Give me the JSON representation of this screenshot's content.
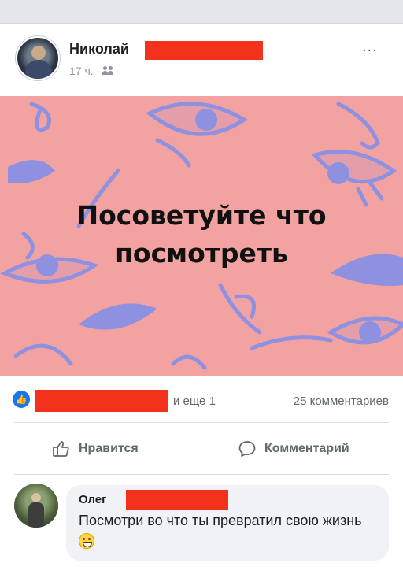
{
  "post": {
    "author": "Николай",
    "time": "17 ч.",
    "meta_separator": "·",
    "privacy_icon": "friends-icon",
    "more_label": "...",
    "image_text": {
      "line1": "Посоветуйте что",
      "line2": "посмотреть"
    },
    "colors": {
      "image_bg": "#f3a2a2",
      "doodle": "#8e90e0",
      "like_blue": "#1877f2",
      "redaction": "#f2321a"
    }
  },
  "reactions": {
    "and_more": "и еще 1",
    "comments_count": "25 комментариев"
  },
  "actions": {
    "like_label": "Нравится",
    "comment_label": "Комментарий"
  },
  "comment": {
    "author": "Олег",
    "text": "Посмотри во что ты превратил свою жизнь",
    "emoji": "grinning-face"
  }
}
